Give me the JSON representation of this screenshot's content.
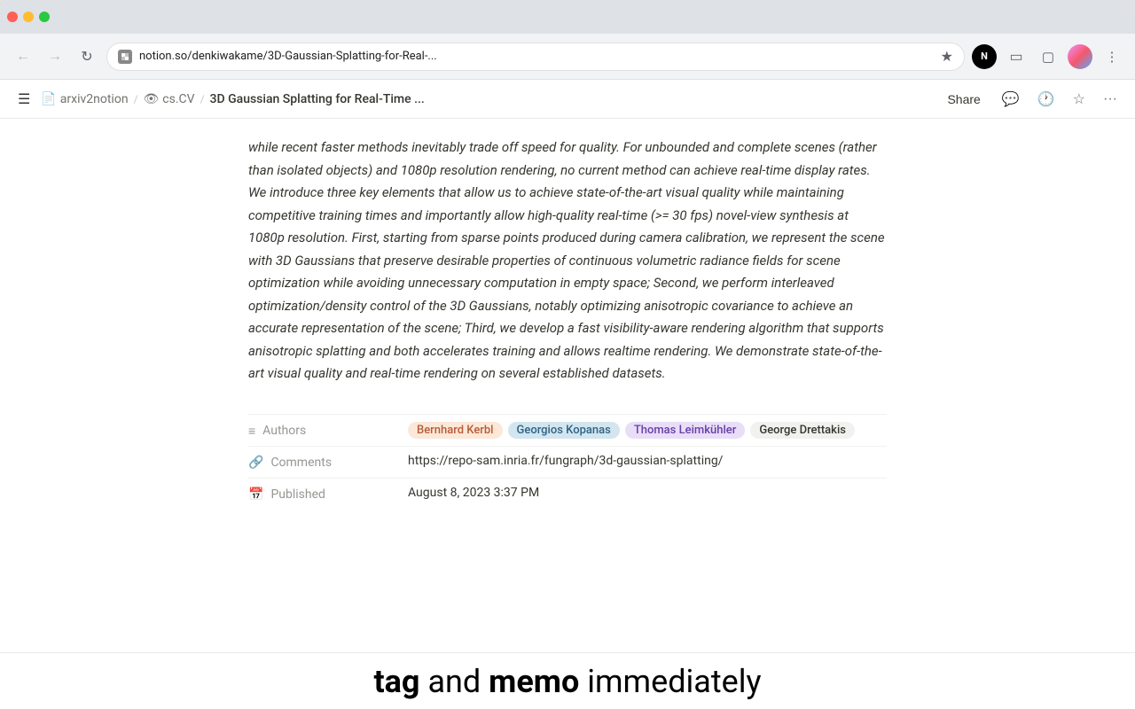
{
  "browser": {
    "address": "notion.so/denkiwakame/3D-Gaussian-Splatting-for-Real-...",
    "back_btn": "←",
    "forward_btn": "→",
    "reload_btn": "↻",
    "extensions_btn": "⊞",
    "more_btn": "⋮"
  },
  "notion_topbar": {
    "menu_icon": "☰",
    "breadcrumb": [
      {
        "label": "arxiv2notion",
        "icon": "📄"
      },
      {
        "label": "cs.CV",
        "icon": "👁"
      },
      {
        "label": "3D Gaussian Splatting for Real-Time ...",
        "icon": ""
      }
    ],
    "share_label": "Share",
    "comment_icon": "💬",
    "history_icon": "🕐",
    "star_icon": "☆",
    "more_icon": "···"
  },
  "article": {
    "abstract": "while recent faster methods inevitably trade off speed for quality. For unbounded and complete scenes (rather than isolated objects) and 1080p resolution rendering, no current method can achieve real-time display rates. We introduce three key elements that allow us to achieve state-of-the-art visual quality while maintaining competitive training times and importantly allow high-quality real-time (>= 30 fps) novel-view synthesis at 1080p resolution. First, starting from sparse points produced during camera calibration, we represent the scene with 3D Gaussians that preserve desirable properties of continuous volumetric radiance fields for scene optimization while avoiding unnecessary computation in empty space; Second, we perform interleaved optimization/density control of the 3D Gaussians, notably optimizing anisotropic covariance to achieve an accurate representation of the scene; Third, we develop a fast visibility-aware rendering algorithm that supports anisotropic splatting and both accelerates training and allows realtime rendering. We demonstrate state-of-the-art visual quality and real-time rendering on several established datasets."
  },
  "properties": {
    "authors": {
      "label": "Authors",
      "icon": "≡",
      "values": [
        {
          "name": "Bernhard Kerbl",
          "style": "orange"
        },
        {
          "name": "Georgios Kopanas",
          "style": "blue"
        },
        {
          "name": "Thomas Leimkühler",
          "style": "purple"
        },
        {
          "name": "George Drettakis",
          "style": "plain"
        }
      ]
    },
    "comments": {
      "label": "Comments",
      "icon": "🔗",
      "value": "https://repo-sam.inria.fr/fungraph/3d-gaussian-splatting/"
    },
    "published": {
      "label": "Published",
      "icon": "📅",
      "value": "August 8, 2023 3:37 PM"
    }
  },
  "bottom_bar": {
    "text_parts": [
      {
        "word": "tag",
        "bold": true
      },
      {
        "word": " and ",
        "bold": false
      },
      {
        "word": "memo",
        "bold": true
      },
      {
        "word": " immediately",
        "bold": false
      }
    ]
  }
}
